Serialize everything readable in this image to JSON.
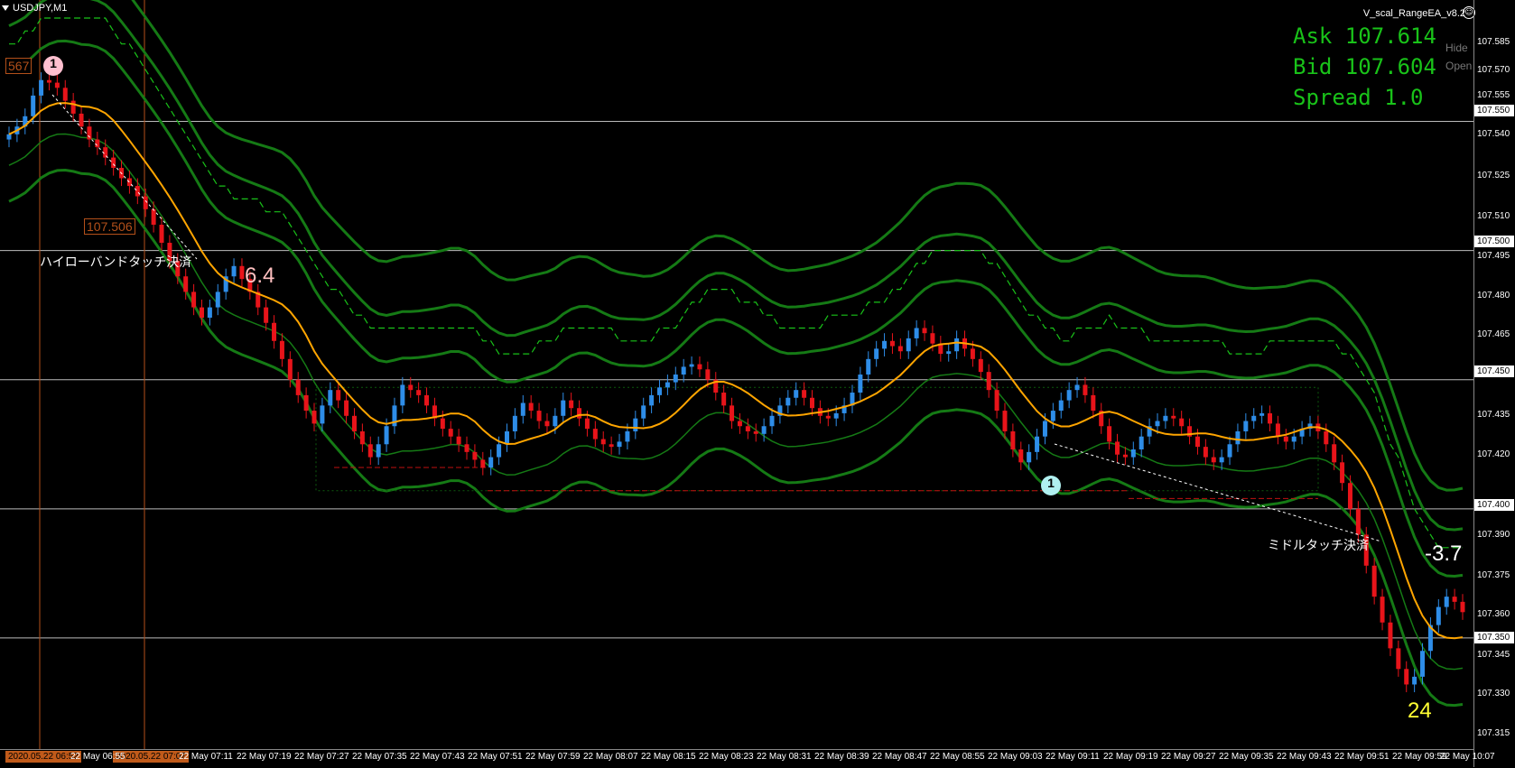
{
  "window": {
    "symbol_tab": "USDJPY,M1",
    "ea_name": "V_scal_RangeEA_v8.2",
    "ea_face": "☺"
  },
  "quotes": {
    "ask": "Ask 107.614",
    "bid": "Bid 107.604",
    "spread": "Spread 1.0",
    "side_tag_1": "Hide",
    "side_tag_2": "Open"
  },
  "price_scale": {
    "labels": [
      "107.585",
      "107.570",
      "107.555",
      "107.540",
      "107.525",
      "107.510",
      "107.495",
      "107.480",
      "107.465",
      "107.435",
      "107.420",
      "107.390",
      "107.375",
      "107.360",
      "107.345",
      "107.330",
      "107.315"
    ],
    "boxes": [
      "107.550",
      "107.500",
      "107.450",
      "107.400",
      "107.350"
    ]
  },
  "time_scale": {
    "highlight_1": "2020.05.22 06:52",
    "highlight_2": "2020.05.22 07:07",
    "labels": [
      "22 May 06:55",
      "22 May 07:11",
      "22 May 07:19",
      "22 May 07:27",
      "22 May 07:35",
      "22 May 07:43",
      "22 May 07:51",
      "22 May 07:59",
      "22 May 08:07",
      "22 May 08:15",
      "22 May 08:23",
      "22 May 08:31",
      "22 May 08:39",
      "22 May 08:47",
      "22 May 08:55",
      "22 May 09:03",
      "22 May 09:11",
      "22 May 09:19",
      "22 May 09:27",
      "22 May 09:35",
      "22 May 09:43",
      "22 May 09:51",
      "22 May 09:59",
      "22 May 10:07"
    ]
  },
  "annotations": {
    "label_567": "567",
    "label_107506": "107.506",
    "close_text_1": "ハイローバンドタッチ決済",
    "close_text_2": "ミドルタッチ決済",
    "profit_1": "6.4",
    "profit_2": "-3.7",
    "count": "24",
    "trade_1": "1",
    "trade_2": "1"
  },
  "colors": {
    "bull": "#2e8de8",
    "bear": "#e8141a",
    "ma": "#ffa500",
    "band": "#157a15",
    "band_dashed": "#19c219",
    "quote_text": "#19c219"
  },
  "chart_data": {
    "type": "candlestick",
    "symbol": "USDJPY",
    "timeframe": "M1",
    "y_range": [
      107.307,
      107.597
    ],
    "horizontal_levels": [
      107.55,
      107.5,
      107.45,
      107.4,
      107.35
    ],
    "close_series": [
      107.545,
      107.548,
      107.552,
      107.56,
      107.566,
      107.565,
      107.563,
      107.558,
      107.553,
      107.548,
      107.543,
      107.54,
      107.536,
      107.532,
      107.528,
      107.525,
      107.521,
      107.516,
      107.51,
      107.503,
      107.496,
      107.49,
      107.484,
      107.478,
      107.474,
      107.478,
      107.484,
      107.49,
      107.494,
      107.489,
      107.484,
      107.478,
      107.472,
      107.465,
      107.458,
      107.45,
      107.444,
      107.438,
      107.433,
      107.44,
      107.446,
      107.442,
      107.436,
      107.43,
      107.425,
      107.42,
      107.425,
      107.432,
      107.44,
      107.448,
      107.446,
      107.444,
      107.44,
      107.435,
      107.431,
      107.428,
      107.425,
      107.422,
      107.419,
      107.416,
      107.42,
      107.425,
      107.43,
      107.436,
      107.441,
      107.438,
      107.434,
      107.432,
      107.436,
      107.442,
      107.439,
      107.435,
      107.431,
      107.427,
      107.425,
      107.424,
      107.426,
      107.43,
      107.435,
      107.44,
      107.444,
      107.447,
      107.449,
      107.452,
      107.455,
      107.456,
      107.454,
      107.45,
      107.445,
      107.44,
      107.434,
      107.432,
      107.43,
      107.429,
      107.432,
      107.436,
      107.44,
      107.443,
      107.446,
      107.443,
      107.439,
      107.436,
      107.435,
      107.437,
      107.44,
      107.445,
      107.452,
      107.458,
      107.462,
      107.465,
      107.463,
      107.461,
      107.466,
      107.47,
      107.468,
      107.464,
      107.46,
      107.461,
      107.466,
      107.462,
      107.458,
      107.453,
      107.446,
      107.438,
      107.43,
      107.423,
      107.418,
      107.422,
      107.428,
      107.434,
      107.438,
      107.442,
      107.446,
      107.448,
      107.444,
      107.438,
      107.432,
      107.426,
      107.421,
      107.42,
      107.423,
      107.428,
      107.432,
      107.434,
      107.436,
      107.435,
      107.432,
      107.428,
      107.424,
      107.42,
      107.418,
      107.42,
      107.425,
      107.43,
      107.434,
      107.436,
      107.437,
      107.433,
      107.428,
      107.426,
      107.428,
      107.431,
      107.433,
      107.43,
      107.425,
      107.418,
      107.41,
      107.4,
      107.39,
      107.378,
      107.366,
      107.356,
      107.346,
      107.338,
      107.332,
      107.335,
      107.345,
      107.355,
      107.362,
      107.366,
      107.364,
      107.36
    ]
  }
}
